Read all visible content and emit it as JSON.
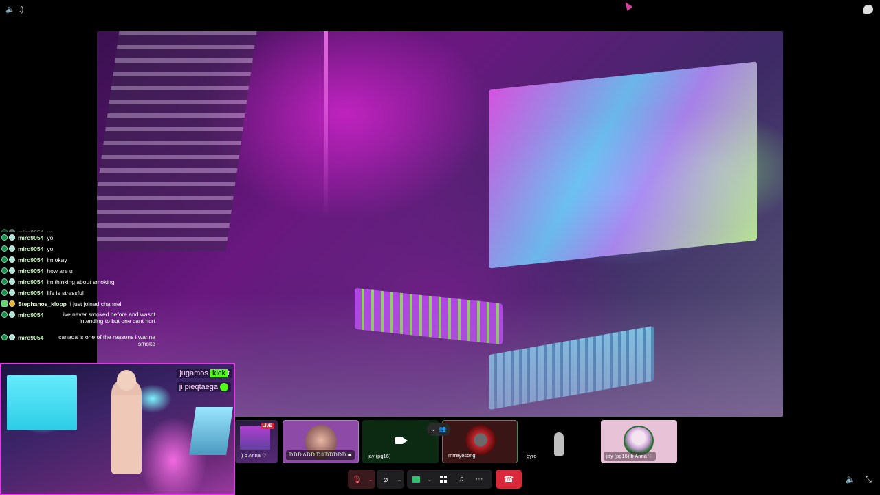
{
  "topbar": {
    "volume_icon": "speaker-icon",
    "title_text": ":)",
    "chat_icon": "chat-bubble-icon"
  },
  "stream": {
    "description_icon": "screen-share-stream"
  },
  "chat": {
    "faded_line": {
      "user": "miro9054",
      "message": "yo"
    },
    "lines": [
      {
        "user": "miro9054",
        "message": "yo"
      },
      {
        "user": "miro9054",
        "message": "yo"
      },
      {
        "user": "miro9054",
        "message": "im okay"
      },
      {
        "user": "miro9054",
        "message": "how are u"
      },
      {
        "user": "miro9054",
        "message": "im thinking about smoking"
      },
      {
        "user": "miro9054",
        "message": "life is stressful"
      },
      {
        "user": "Stephanos_klopp",
        "message": "i just joined channel"
      },
      {
        "user": "miro9054",
        "message": "ive never smoked before and wasnt intending to but one cant hurt"
      },
      {
        "user": "miro9054",
        "message": "canada is one of the reasons i wanna smoke"
      }
    ]
  },
  "webcam": {
    "overlay_line1_prefix": "jugamos",
    "overlay_line1_highlight": "kick",
    "overlay_line1_suffix": "t",
    "overlay_line2": "ji pieqtaega"
  },
  "participants": [
    {
      "label": ") b Anna ♡",
      "live_badge": "LIVE"
    },
    {
      "label": "ᗪᗪᗪ ∆ᗪᗪ ᗪ▯ᗪᗪᗪᗪᗪᴐ■"
    },
    {
      "label": "jay (pg16)"
    },
    {
      "label": "mrreyesong"
    },
    {
      "label": "gyro"
    },
    {
      "label": "jay (pg16) b Anna ♡"
    }
  ],
  "controls": {
    "mute_icon": "mic-off-icon",
    "video_icon": "video-off-icon",
    "share_icon": "screen-share-icon",
    "activities_icon": "grid-icon",
    "soundboard_icon": "soundboard-icon",
    "more_icon": "more-dots-icon",
    "end_call_icon": "phone-hangup-icon",
    "more_label": "···",
    "caret": "⌄"
  },
  "bottom_right": {
    "volume_icon": "speaker-icon",
    "fullscreen_icon": "exit-fullscreen-icon"
  }
}
